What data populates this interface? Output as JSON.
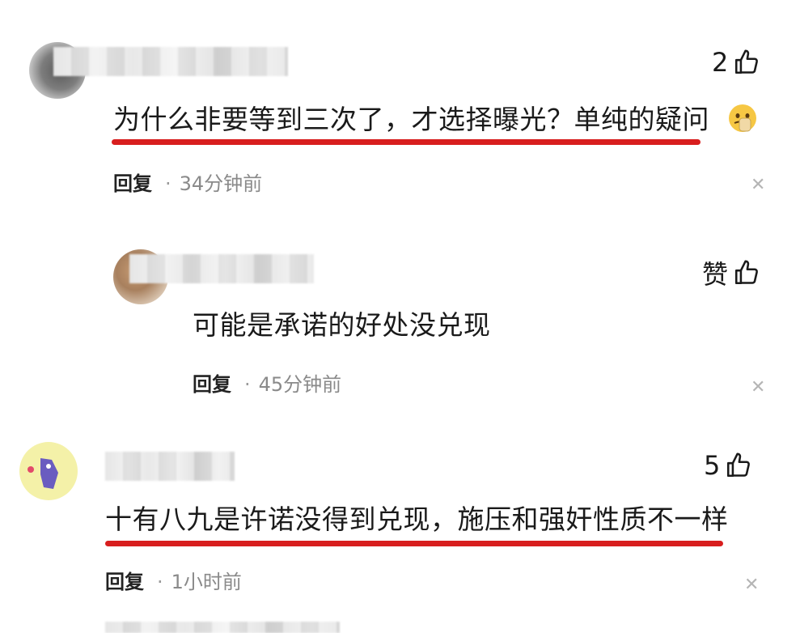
{
  "comments": [
    {
      "text": "为什么非要等到三次了，才选择曝光？单纯的疑问",
      "likes": "2",
      "reply_label": "回复",
      "separator": "·",
      "time": "34分钟前"
    },
    {
      "text": "可能是承诺的好处没兑现",
      "likes": "赞",
      "reply_label": "回复",
      "separator": "·",
      "time": "45分钟前"
    },
    {
      "text": "十有八九是许诺没得到兑现，施压和强奸性质不一样",
      "likes": "5",
      "reply_label": "回复",
      "separator": "·",
      "time": "1小时前"
    }
  ],
  "icons": {
    "like": "thumbs-up-icon",
    "close": "close-icon",
    "emoji": "face-emoji-icon"
  },
  "colors": {
    "underline": "#d81e1e",
    "meta_text": "#8a8a8a"
  }
}
